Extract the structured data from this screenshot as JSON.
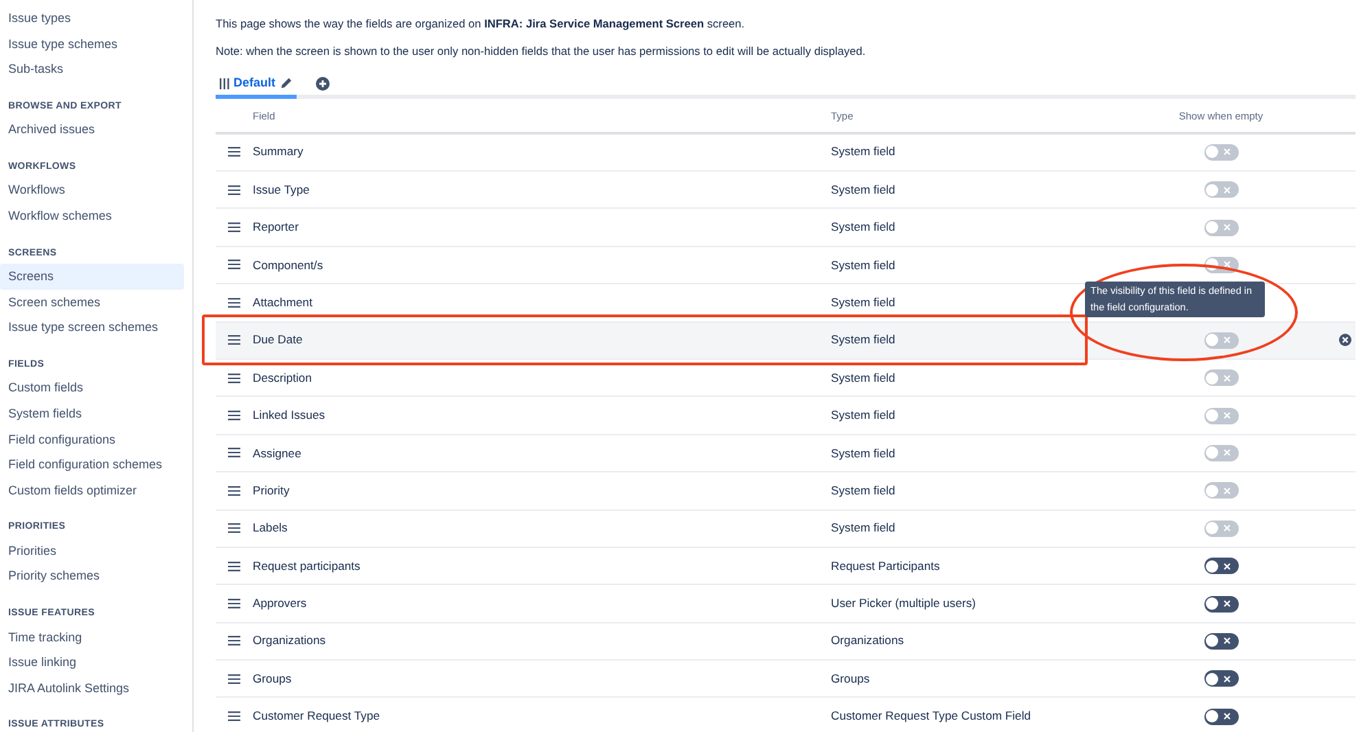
{
  "sidebar": {
    "groups": [
      {
        "items": [
          {
            "label": "Issue types",
            "selected": false
          },
          {
            "label": "Issue type schemes",
            "selected": false
          },
          {
            "label": "Sub-tasks",
            "selected": false
          }
        ]
      },
      {
        "heading": "BROWSE AND EXPORT",
        "items": [
          {
            "label": "Archived issues",
            "selected": false
          }
        ]
      },
      {
        "heading": "WORKFLOWS",
        "items": [
          {
            "label": "Workflows",
            "selected": false
          },
          {
            "label": "Workflow schemes",
            "selected": false
          }
        ]
      },
      {
        "heading": "SCREENS",
        "items": [
          {
            "label": "Screens",
            "selected": true
          },
          {
            "label": "Screen schemes",
            "selected": false
          },
          {
            "label": "Issue type screen schemes",
            "selected": false
          }
        ]
      },
      {
        "heading": "FIELDS",
        "items": [
          {
            "label": "Custom fields",
            "selected": false
          },
          {
            "label": "System fields",
            "selected": false
          },
          {
            "label": "Field configurations",
            "selected": false
          },
          {
            "label": "Field configuration schemes",
            "selected": false
          },
          {
            "label": "Custom fields optimizer",
            "selected": false
          }
        ]
      },
      {
        "heading": "PRIORITIES",
        "items": [
          {
            "label": "Priorities",
            "selected": false
          },
          {
            "label": "Priority schemes",
            "selected": false
          }
        ]
      },
      {
        "heading": "ISSUE FEATURES",
        "items": [
          {
            "label": "Time tracking",
            "selected": false
          },
          {
            "label": "Issue linking",
            "selected": false
          },
          {
            "label": "JIRA Autolink Settings",
            "selected": false
          }
        ]
      },
      {
        "heading": "ISSUE ATTRIBUTES"
      }
    ]
  },
  "description": "This page shows the way the fields are organized on **INFRA: Jira Service Management Screen** screen.",
  "note": "Note: when the screen is shown to the user only non-hidden fields that the user has permissions to edit will be actually displayed.",
  "tabs": [
    {
      "label": "Default",
      "selected": true
    }
  ],
  "table": {
    "columns": [
      "Field",
      "Type",
      "Show when empty"
    ],
    "rows": [
      {
        "field": "Summary",
        "type": "System field",
        "show_when_empty": false,
        "disabled": true,
        "hovered": false
      },
      {
        "field": "Issue Type",
        "type": "System field",
        "show_when_empty": false,
        "disabled": true,
        "hovered": false
      },
      {
        "field": "Reporter",
        "type": "System field",
        "show_when_empty": false,
        "disabled": true,
        "hovered": false
      },
      {
        "field": "Component/s",
        "type": "System field",
        "show_when_empty": false,
        "disabled": true,
        "hovered": false
      },
      {
        "field": "Attachment",
        "type": "System field",
        "hovered": false
      },
      {
        "field": "Due Date",
        "type": "System field",
        "show_when_empty": false,
        "disabled": true,
        "hovered": true,
        "annotated": true
      },
      {
        "field": "Description",
        "type": "System field",
        "show_when_empty": false,
        "disabled": true,
        "hovered": false
      },
      {
        "field": "Linked Issues",
        "type": "System field",
        "show_when_empty": false,
        "disabled": true,
        "hovered": false
      },
      {
        "field": "Assignee",
        "type": "System field",
        "show_when_empty": false,
        "disabled": true,
        "hovered": false
      },
      {
        "field": "Priority",
        "type": "System field",
        "show_when_empty": false,
        "disabled": true,
        "hovered": false
      },
      {
        "field": "Labels",
        "type": "System field",
        "show_when_empty": false,
        "disabled": true,
        "hovered": false
      },
      {
        "field": "Request participants",
        "type": "Request Participants",
        "show_when_empty": false,
        "disabled": false,
        "hovered": false
      },
      {
        "field": "Approvers",
        "type": "User Picker (multiple users)",
        "show_when_empty": false,
        "disabled": false,
        "hovered": false
      },
      {
        "field": "Organizations",
        "type": "Organizations",
        "show_when_empty": false,
        "disabled": false,
        "hovered": false
      },
      {
        "field": "Groups",
        "type": "Groups",
        "show_when_empty": false,
        "disabled": false,
        "hovered": false
      },
      {
        "field": "Customer Request Type",
        "type": "Customer Request Type Custom Field",
        "show_when_empty": false,
        "disabled": false,
        "hovered": false
      }
    ]
  },
  "tooltip": {
    "text": "The visibility of this field is defined in the field configuration.",
    "annotated": true
  }
}
